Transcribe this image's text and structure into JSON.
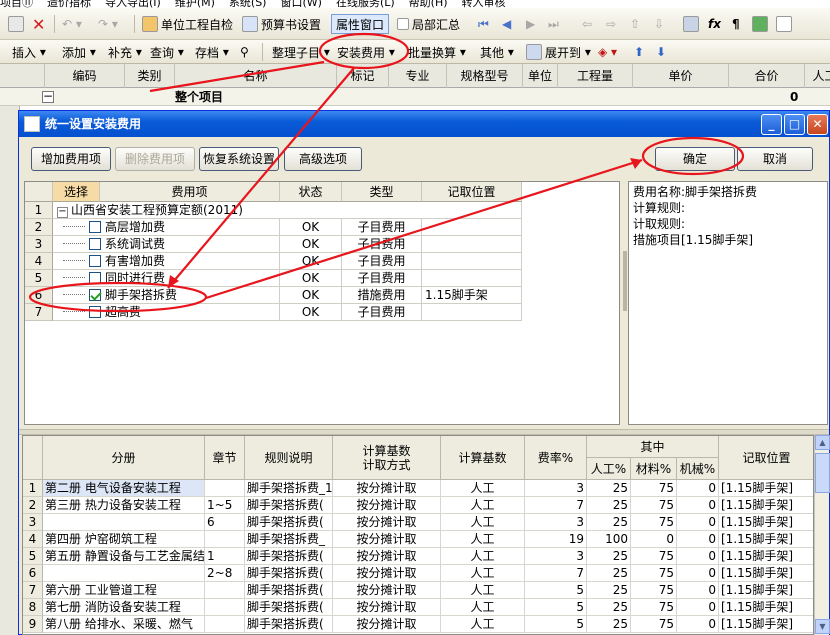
{
  "menubar": [
    "项目⑪",
    "造价指标",
    "导入导出(I)",
    "维护(M)",
    "系统(S)",
    "窗口(W)",
    "在线服务(L)",
    "帮助(H)",
    "转入审核"
  ],
  "toolbar1": {
    "unit_check": "单位工程自检",
    "budget_settings": "预算书设置",
    "property_window": "属性窗口",
    "partial_summary": "局部汇总"
  },
  "toolbar2": {
    "insert": "插入",
    "add": "添加",
    "supplement": "补充",
    "query": "查询",
    "archive": "存档",
    "organize": "整理子目",
    "install_fee": "安装费用",
    "batch_convert": "批量换算",
    "other": "其他",
    "expand_to": "展开到"
  },
  "grid_headers": [
    "编码",
    "类别",
    "名称",
    "标记",
    "专业",
    "规格型号",
    "单位",
    "工程量",
    "单价",
    "合价",
    "人工"
  ],
  "grid_row1": {
    "expander": "−",
    "name": "整个项目",
    "total": "0"
  },
  "dialog": {
    "title": "统一设置安装费用",
    "buttons": {
      "add_fee": "增加费用项",
      "delete_fee": "删除费用项",
      "restore": "恢复系统设置",
      "advanced": "高级选项",
      "ok": "确定",
      "cancel": "取消"
    },
    "fee_table": {
      "headers": [
        "选择",
        "费用项",
        "状态",
        "类型",
        "记取位置"
      ],
      "group_label": "山西省安装工程预算定额(2011)",
      "rows": [
        {
          "num": "1"
        },
        {
          "num": "2",
          "name": "高层增加费",
          "status": "OK",
          "type": "子目费用",
          "pos": "",
          "checked": false
        },
        {
          "num": "3",
          "name": "系统调试费",
          "status": "OK",
          "type": "子目费用",
          "pos": "",
          "checked": false
        },
        {
          "num": "4",
          "name": "有害增加费",
          "status": "OK",
          "type": "子目费用",
          "pos": "",
          "checked": false
        },
        {
          "num": "5",
          "name": "同时进行费",
          "status": "OK",
          "type": "子目费用",
          "pos": "",
          "checked": false
        },
        {
          "num": "6",
          "name": "脚手架搭拆费",
          "status": "OK",
          "type": "措施费用",
          "pos": "1.15脚手架",
          "checked": true
        },
        {
          "num": "7",
          "name": "超高费",
          "status": "OK",
          "type": "子目费用",
          "pos": "",
          "checked": false
        }
      ]
    },
    "info_lines": [
      "费用名称:脚手架搭拆费",
      "计算规则:",
      "计取规则:",
      "措施项目[1.15脚手架]"
    ],
    "rule_table": {
      "headers": {
        "part": "分册",
        "chapter": "章节",
        "rule": "规则说明",
        "base_method": "计算基数\n计取方式",
        "base": "计算基数",
        "rate": "费率%",
        "group": "其中",
        "labor": "人工%",
        "material": "材料%",
        "machine": "机械%",
        "position": "记取位置"
      },
      "rows": [
        {
          "n": "1",
          "part": "第二册 电气设备安装工程",
          "chapter": "",
          "rule": "脚手架搭拆费_1",
          "method": "按分摊计取",
          "base": "人工",
          "rate": "3",
          "labor": "25",
          "material": "75",
          "machine": "0",
          "pos": "[1.15脚手架]"
        },
        {
          "n": "2",
          "part": "第三册 热力设备安装工程",
          "chapter": "1~5",
          "rule": "脚手架搭拆费(",
          "method": "按分摊计取",
          "base": "人工",
          "rate": "7",
          "labor": "25",
          "material": "75",
          "machine": "0",
          "pos": "[1.15脚手架]"
        },
        {
          "n": "3",
          "part": "",
          "chapter": "6",
          "rule": "脚手架搭拆费(",
          "method": "按分摊计取",
          "base": "人工",
          "rate": "3",
          "labor": "25",
          "material": "75",
          "machine": "0",
          "pos": "[1.15脚手架]"
        },
        {
          "n": "4",
          "part": "第四册 炉窑砌筑工程",
          "chapter": "",
          "rule": "脚手架搭拆费_",
          "method": "按分摊计取",
          "base": "人工",
          "rate": "19",
          "labor": "100",
          "material": "0",
          "machine": "0",
          "pos": "[1.15脚手架]"
        },
        {
          "n": "5",
          "part": "第五册 静置设备与工艺金属结构制作工程",
          "chapter": "1",
          "rule": "脚手架搭拆费(",
          "method": "按分摊计取",
          "base": "人工",
          "rate": "3",
          "labor": "25",
          "material": "75",
          "machine": "0",
          "pos": "[1.15脚手架]"
        },
        {
          "n": "6",
          "part": "",
          "chapter": "2~8",
          "rule": "脚手架搭拆费(",
          "method": "按分摊计取",
          "base": "人工",
          "rate": "7",
          "labor": "25",
          "material": "75",
          "machine": "0",
          "pos": "[1.15脚手架]"
        },
        {
          "n": "7",
          "part": "第六册 工业管道工程",
          "chapter": "",
          "rule": "脚手架搭拆费(",
          "method": "按分摊计取",
          "base": "人工",
          "rate": "5",
          "labor": "25",
          "material": "75",
          "machine": "0",
          "pos": "[1.15脚手架]"
        },
        {
          "n": "8",
          "part": "第七册 消防设备安装工程",
          "chapter": "",
          "rule": "脚手架搭拆费(",
          "method": "按分摊计取",
          "base": "人工",
          "rate": "5",
          "labor": "25",
          "material": "75",
          "machine": "0",
          "pos": "[1.15脚手架]"
        },
        {
          "n": "9",
          "part": "第八册 给排水、采暖、燃气",
          "chapter": "",
          "rule": "脚手架搭拆费(",
          "method": "按分摊计取",
          "base": "人工",
          "rate": "5",
          "labor": "25",
          "material": "75",
          "machine": "0",
          "pos": "[1.15脚手架]"
        }
      ]
    }
  },
  "annotation_color": "#e8151c"
}
